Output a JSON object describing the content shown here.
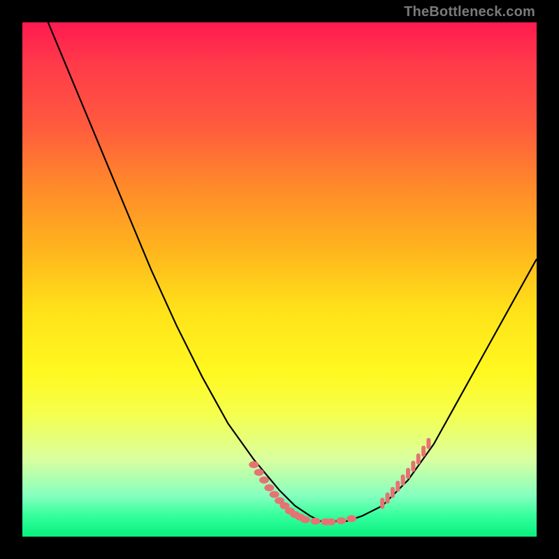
{
  "watermark": "TheBottleneck.com",
  "colors": {
    "background": "#000000",
    "gradient_top": "#ff1a50",
    "gradient_mid": "#ffe219",
    "gradient_bottom": "#08f07e",
    "curve": "#000000",
    "scatter": "#e57373"
  },
  "chart_data": {
    "type": "line",
    "title": "",
    "xlabel": "",
    "ylabel": "",
    "xlim": [
      0,
      100
    ],
    "ylim": [
      0,
      100
    ],
    "series": [
      {
        "name": "bottleneck-curve",
        "x": [
          5,
          10,
          15,
          20,
          25,
          30,
          35,
          40,
          45,
          50,
          53,
          56,
          58,
          60,
          63,
          66,
          70,
          75,
          80,
          85,
          90,
          95,
          100
        ],
        "y": [
          100,
          88,
          76,
          64,
          52,
          41,
          31,
          22,
          15,
          9,
          6,
          4,
          3,
          3,
          3,
          4,
          6,
          11,
          18,
          27,
          36,
          45,
          54
        ]
      },
      {
        "name": "scatter-left-arm",
        "x": [
          45,
          46,
          47,
          48,
          49,
          50,
          51,
          52,
          53,
          54
        ],
        "y": [
          14,
          12.5,
          11,
          9.5,
          8.2,
          7,
          6,
          5,
          4.3,
          3.8
        ]
      },
      {
        "name": "scatter-trough",
        "x": [
          55,
          57,
          59,
          60,
          62,
          64
        ],
        "y": [
          3.3,
          3.0,
          2.9,
          2.9,
          3.1,
          3.5
        ]
      },
      {
        "name": "scatter-right-arm",
        "x": [
          70,
          71,
          72,
          73,
          74,
          75,
          76,
          77,
          78,
          79
        ],
        "y": [
          6.5,
          7.5,
          8.6,
          9.8,
          11,
          12.3,
          13.7,
          15.1,
          16.6,
          18.1
        ]
      }
    ],
    "annotations": []
  }
}
